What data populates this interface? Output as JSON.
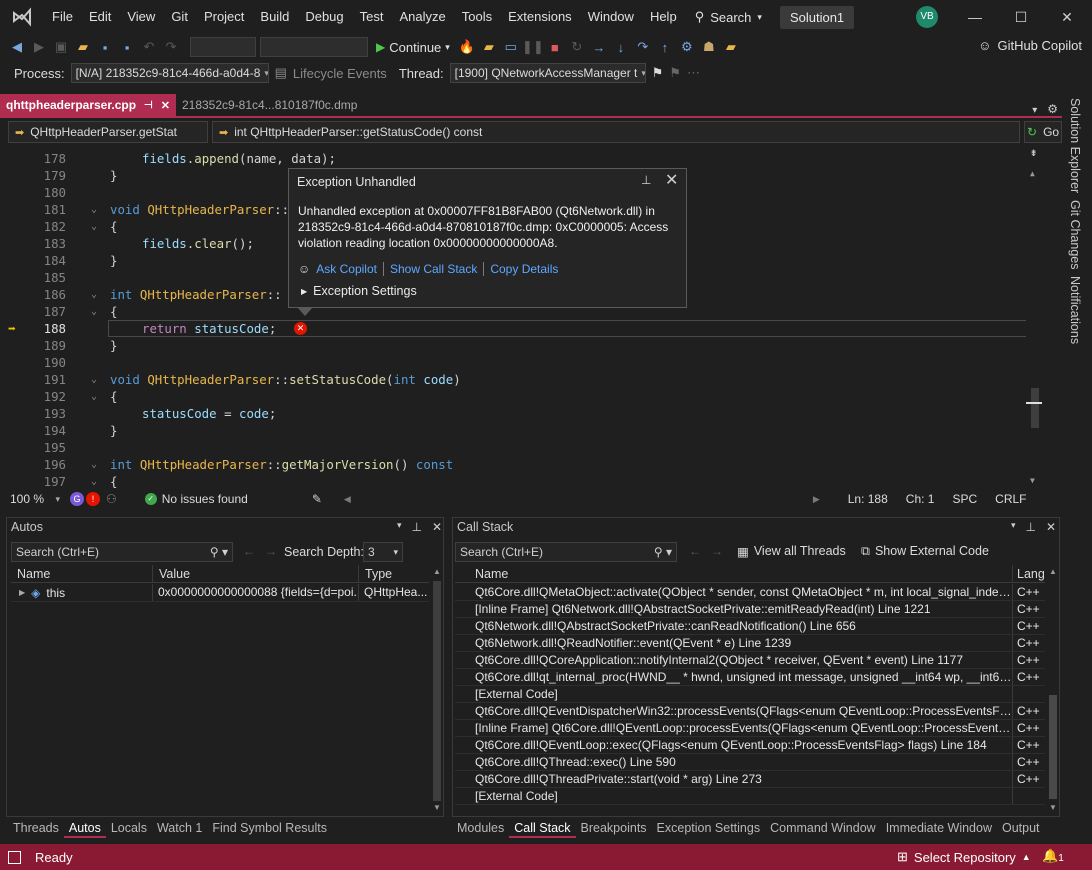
{
  "menu": [
    "File",
    "Edit",
    "View",
    "Git",
    "Project",
    "Build",
    "Debug",
    "Test",
    "Analyze",
    "Tools",
    "Extensions",
    "Window",
    "Help"
  ],
  "search_label": "Search",
  "solution_name": "Solution1",
  "user_initials": "VB",
  "toolbar": {
    "continue_label": "Continue",
    "copilot_label": "GitHub Copilot"
  },
  "debug_location": {
    "process_label": "Process:",
    "process_value": "[N/A] 218352c9-81c4-466d-a0d4-8",
    "lifecycle_label": "Lifecycle Events",
    "thread_label": "Thread:",
    "thread_value": "[1900] QNetworkAccessManager t"
  },
  "tabs": [
    {
      "label": "qhttpheaderparser.cpp"
    },
    {
      "label": "218352c9-81c4...810187f0c.dmp"
    }
  ],
  "nav": {
    "scope": "QHttpHeaderParser.getStat",
    "member": "int QHttpHeaderParser::getStatusCode() const",
    "go_label": "Go"
  },
  "code_lines": [
    {
      "num": "178"
    },
    {
      "num": "179"
    },
    {
      "num": "180"
    },
    {
      "num": "181"
    },
    {
      "num": "182"
    },
    {
      "num": "183"
    },
    {
      "num": "184"
    },
    {
      "num": "185"
    },
    {
      "num": "186"
    },
    {
      "num": "187"
    },
    {
      "num": "188"
    },
    {
      "num": "189"
    },
    {
      "num": "190"
    },
    {
      "num": "191"
    },
    {
      "num": "192"
    },
    {
      "num": "193"
    },
    {
      "num": "194"
    },
    {
      "num": "195"
    },
    {
      "num": "196"
    },
    {
      "num": "197"
    }
  ],
  "code_text": {
    "l178_fields": "fields",
    "l178_append": "append",
    "l178_args": "(name, data);",
    "void": "void",
    "int": "int",
    "class": "QHttpHeaderParser",
    "scope": "::",
    "clear": "clear",
    "return": "return",
    "statusCode": "statusCode",
    "setStatusCode": "setStatusCode",
    "code": "code",
    "getMajorVersion": "getMajorVersion",
    "const": "const"
  },
  "exception": {
    "title": "Exception Unhandled",
    "message": "Unhandled exception at 0x00007FF81B8FAB00 (Qt6Network.dll) in 218352c9-81c4-466d-a0d4-870810187f0c.dmp: 0xC0000005: Access violation reading location 0x00000000000000A8.",
    "ask_copilot": "Ask Copilot",
    "show_call_stack": "Show Call Stack",
    "copy_details": "Copy Details",
    "settings": "Exception Settings"
  },
  "editor_status": {
    "zoom": "100 %",
    "issues": "No issues found",
    "ln": "Ln: 188",
    "ch": "Ch: 1",
    "spc": "SPC",
    "crlf": "CRLF"
  },
  "autos": {
    "title": "Autos",
    "search_placeholder": "Search (Ctrl+E)",
    "depth_label": "Search Depth:",
    "depth_value": "3",
    "columns": [
      "Name",
      "Value",
      "Type"
    ],
    "rows": [
      {
        "name": "this",
        "value": "0x0000000000000088 {fields={d=poi...",
        "type": "QHttpHea..."
      }
    ]
  },
  "callstack": {
    "title": "Call Stack",
    "search_placeholder": "Search (Ctrl+E)",
    "view_all_threads": "View all Threads",
    "show_external": "Show External Code",
    "columns": [
      "Name",
      "Lang"
    ],
    "rows": [
      {
        "name": "Qt6Core.dll!QMetaObject::activate(QObject * sender, const QMetaObject * m, int local_signal_index, ...",
        "lang": "C++"
      },
      {
        "name": "[Inline Frame] Qt6Network.dll!QAbstractSocketPrivate::emitReadyRead(int) Line 1221",
        "lang": "C++"
      },
      {
        "name": "Qt6Network.dll!QAbstractSocketPrivate::canReadNotification() Line 656",
        "lang": "C++"
      },
      {
        "name": "Qt6Network.dll!QReadNotifier::event(QEvent * e) Line 1239",
        "lang": "C++"
      },
      {
        "name": "Qt6Core.dll!QCoreApplication::notifyInternal2(QObject * receiver, QEvent * event) Line 1177",
        "lang": "C++"
      },
      {
        "name": "Qt6Core.dll!qt_internal_proc(HWND__ * hwnd, unsigned int message, unsigned __int64 wp, __int64 lp...",
        "lang": "C++"
      },
      {
        "name": "[External Code]",
        "lang": ""
      },
      {
        "name": "Qt6Core.dll!QEventDispatcherWin32::processEvents(QFlags<enum QEventLoop::ProcessEventsFlag> ...",
        "lang": "C++"
      },
      {
        "name": "[Inline Frame] Qt6Core.dll!QEventLoop::processEvents(QFlags<enum QEventLoop::ProcessEventsFla...",
        "lang": "C++"
      },
      {
        "name": "Qt6Core.dll!QEventLoop::exec(QFlags<enum QEventLoop::ProcessEventsFlag> flags) Line 184",
        "lang": "C++"
      },
      {
        "name": "Qt6Core.dll!QThread::exec() Line 590",
        "lang": "C++"
      },
      {
        "name": "Qt6Core.dll!QThreadPrivate::start(void * arg) Line 273",
        "lang": "C++"
      },
      {
        "name": "[External Code]",
        "lang": ""
      }
    ]
  },
  "left_bottom_tabs": [
    "Threads",
    "Autos",
    "Locals",
    "Watch 1",
    "Find Symbol Results"
  ],
  "right_bottom_tabs": [
    "Modules",
    "Call Stack",
    "Breakpoints",
    "Exception Settings",
    "Command Window",
    "Immediate Window",
    "Output"
  ],
  "side_tabs": [
    "Solution Explorer",
    "Git Changes",
    "Notifications"
  ],
  "status": {
    "ready": "Ready",
    "select_repo": "Select Repository",
    "notif_count": "1"
  },
  "colors": {
    "accent": "#b12c51",
    "statusbar": "#8a1a33",
    "error": "#e51400"
  }
}
